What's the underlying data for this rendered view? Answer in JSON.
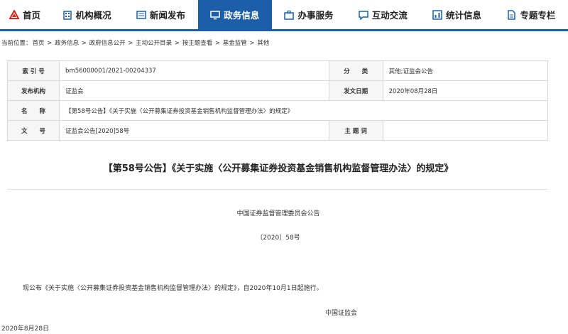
{
  "nav": {
    "items": [
      {
        "label": "首页",
        "icon": "home-logo-icon",
        "active": false
      },
      {
        "label": "机构概况",
        "icon": "building-icon",
        "active": false
      },
      {
        "label": "新闻发布",
        "icon": "news-icon",
        "active": false
      },
      {
        "label": "政务信息",
        "icon": "monitor-icon",
        "active": true
      },
      {
        "label": "办事服务",
        "icon": "service-icon",
        "active": false
      },
      {
        "label": "互动交流",
        "icon": "chat-icon",
        "active": false
      },
      {
        "label": "统计信息",
        "icon": "stats-icon",
        "active": false
      },
      {
        "label": "专题专栏",
        "icon": "document-icon",
        "active": false
      }
    ],
    "accent": "#1c5fa8"
  },
  "breadcrumb": {
    "prefix": "当前位置：",
    "items": [
      "首页",
      "政务信息",
      "政府信息公开",
      "主动公开目录",
      "按主题查看",
      "基金监管",
      "其他"
    ],
    "separator": " > "
  },
  "meta": {
    "index_label": "索 引 号",
    "index_value": "bm56000001/2021-00204337",
    "category_label": "分　　类",
    "category_value": "其他;证监会公告",
    "issuer_label": "发布机构",
    "issuer_value": "证监会",
    "date_label": "发文日期",
    "date_value": "2020年08月28日",
    "name_label": "名　　称",
    "name_value": "【第58号公告】《关于实施〈公开募集证券投资基金销售机构监督管理办法〉的规定》",
    "docno_label": "文　　号",
    "docno_value": "证监会公告[2020]58号",
    "subject_label": "主 题 词",
    "subject_value": ""
  },
  "article": {
    "title": "【第58号公告】《关于实施〈公开募集证券投资基金销售机构监督管理办法〉的规定》",
    "org": "中国证券监督管理委员会公告",
    "number": "〔2020〕58号",
    "body": "现公布《关于实施〈公开募集证券投资基金销售机构监督管理办法〉的规定》，自2020年10月1日起施行。",
    "sign": "中国证监会",
    "date": "2020年8月28日"
  }
}
